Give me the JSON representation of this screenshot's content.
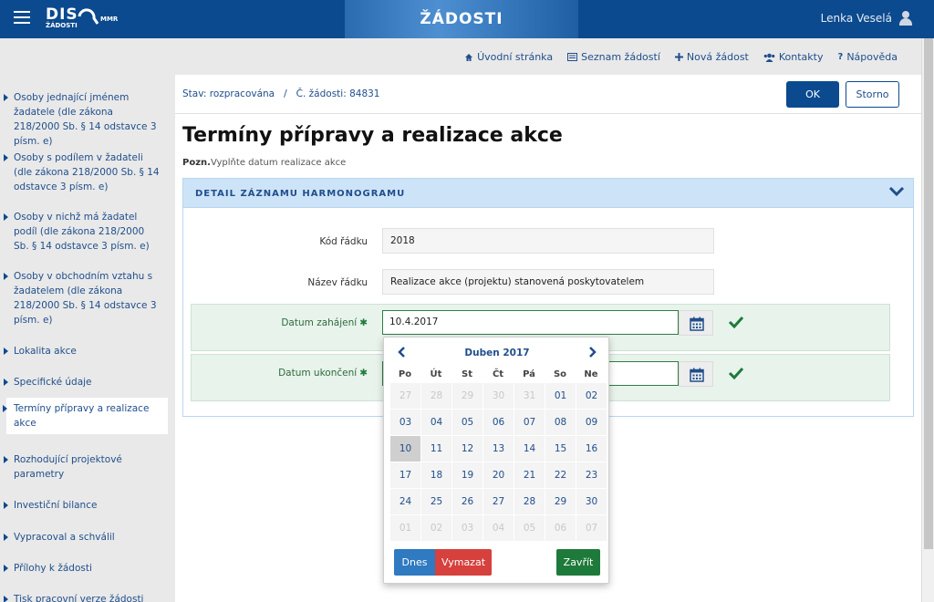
{
  "header": {
    "logo_main": "DIS",
    "logo_sub": "ŽÁDOSTI",
    "logo_org": "MMR",
    "banner_title": "ŽÁDOSTI",
    "user_name": "Lenka Veselá"
  },
  "nav": {
    "links": [
      {
        "label": "Úvodní stránka",
        "icon": "home-icon"
      },
      {
        "label": "Seznam žádostí",
        "icon": "list-icon"
      },
      {
        "label": "Nová žádost",
        "icon": "plus-icon"
      },
      {
        "label": "Kontakty",
        "icon": "users-icon"
      },
      {
        "label": "Nápověda",
        "icon": "help-icon"
      }
    ]
  },
  "sidebar": {
    "items": [
      {
        "label": "Osoby jednající jménem žadatele (dle zákona 218/2000 Sb. § 14 odstavce 3 písm. e)"
      },
      {
        "label": "Osoby s podílem v žadateli (dle zákona 218/2000 Sb. § 14 odstavce 3 písm. e)"
      },
      {
        "label": "Osoby v nichž má žadatel podíl (dle zákona 218/2000 Sb. § 14 odstavce 3 písm. e)"
      },
      {
        "label": "Osoby v obchodním vztahu s žadatelem (dle zákona 218/2000 Sb. § 14 odstavce 3 písm. e)"
      },
      {
        "label": "Lokalita akce"
      },
      {
        "label": "Specifické údaje"
      },
      {
        "label": "Termíny přípravy a realizace akce"
      },
      {
        "label": "Rozhodující projektové parametry"
      },
      {
        "label": "Investiční bilance"
      },
      {
        "label": "Vypracoval a schválil"
      },
      {
        "label": "Přílohy k žádosti"
      },
      {
        "label": "Tisk pracovní verze žádosti"
      }
    ]
  },
  "main": {
    "status": "Stav: rozpracována   /   Č. žádosti: 84831",
    "ok_label": "OK",
    "storno_label": "Storno",
    "title": "Termíny přípravy a realizace akce",
    "note_prefix": "Pozn.",
    "note_text": "Vyplňte datum realizace akce",
    "panel_title": "DETAIL ZÁZNAMU HARMONOGRAMU",
    "fields": {
      "kod_label": "Kód řádku",
      "kod_value": "2018",
      "nazev_label": "Název řádku",
      "nazev_value": "Realizace akce (projektu) stanovená poskytovatelem",
      "zahajeni_label": "Datum zahájení",
      "zahajeni_value": "10.4.2017",
      "ukonceni_label": "Datum ukončení",
      "ukonceni_value": "",
      "required_mark": "✱"
    }
  },
  "datepicker": {
    "month_title": "Duben 2017",
    "dow": [
      "Po",
      "Út",
      "St",
      "Čt",
      "Pá",
      "So",
      "Ne"
    ],
    "weeks": [
      [
        {
          "d": "27",
          "old": true
        },
        {
          "d": "28",
          "old": true
        },
        {
          "d": "29",
          "old": true
        },
        {
          "d": "30",
          "old": true
        },
        {
          "d": "31",
          "old": true
        },
        {
          "d": "01"
        },
        {
          "d": "02"
        }
      ],
      [
        {
          "d": "03"
        },
        {
          "d": "04"
        },
        {
          "d": "05"
        },
        {
          "d": "06"
        },
        {
          "d": "07"
        },
        {
          "d": "08"
        },
        {
          "d": "09"
        }
      ],
      [
        {
          "d": "10",
          "sel": true
        },
        {
          "d": "11"
        },
        {
          "d": "12"
        },
        {
          "d": "13"
        },
        {
          "d": "14"
        },
        {
          "d": "15"
        },
        {
          "d": "16"
        }
      ],
      [
        {
          "d": "17"
        },
        {
          "d": "18"
        },
        {
          "d": "19"
        },
        {
          "d": "20"
        },
        {
          "d": "21"
        },
        {
          "d": "22"
        },
        {
          "d": "23"
        }
      ],
      [
        {
          "d": "24"
        },
        {
          "d": "25"
        },
        {
          "d": "26"
        },
        {
          "d": "27"
        },
        {
          "d": "28"
        },
        {
          "d": "29"
        },
        {
          "d": "30"
        }
      ],
      [
        {
          "d": "01",
          "old": true
        },
        {
          "d": "02",
          "old": true
        },
        {
          "d": "03",
          "old": true
        },
        {
          "d": "04",
          "old": true
        },
        {
          "d": "05",
          "old": true
        },
        {
          "d": "06",
          "old": true
        },
        {
          "d": "07",
          "old": true
        }
      ]
    ],
    "today_label": "Dnes",
    "clear_label": "Vymazat",
    "close_label": "Zavřít"
  },
  "colors": {
    "brand_blue": "#0b4a8e",
    "success_green": "#1e7a3a",
    "danger_red": "#d6403d",
    "info_blue": "#2f7ac0"
  }
}
